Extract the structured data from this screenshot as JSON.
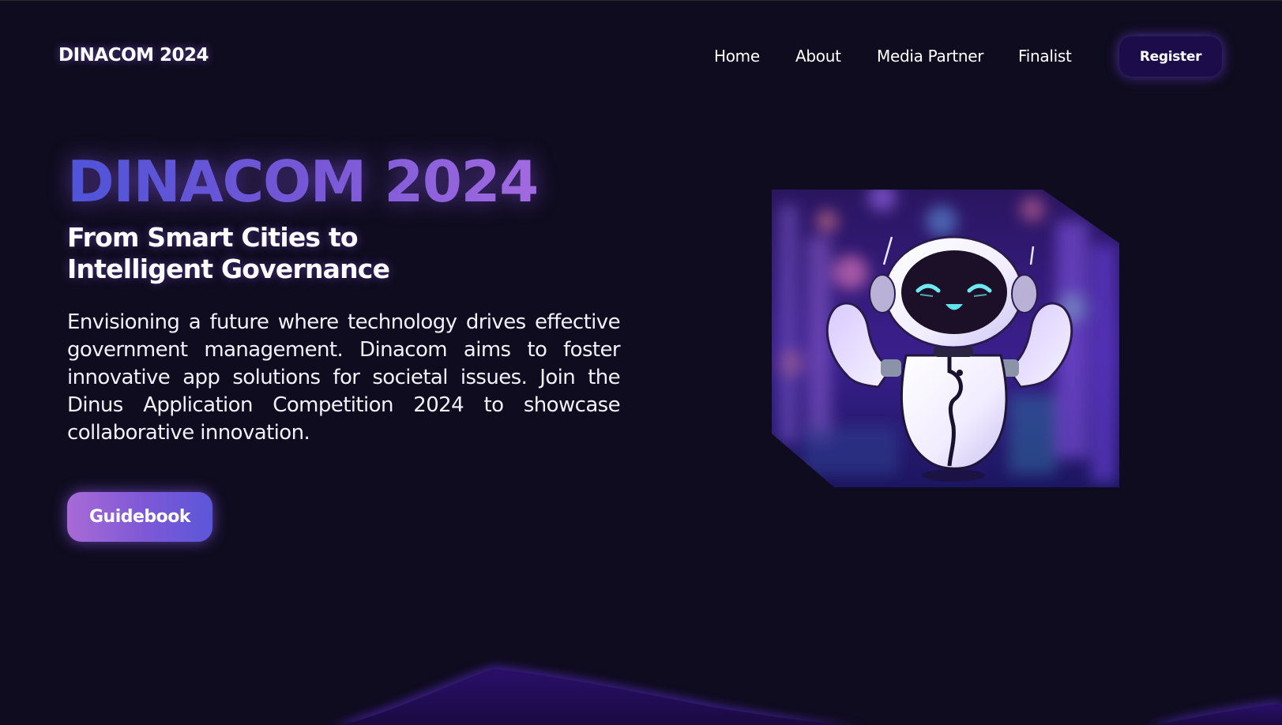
{
  "brand": {
    "name": "DINACOM 2024"
  },
  "nav": {
    "items": [
      {
        "label": "Home"
      },
      {
        "label": "About"
      },
      {
        "label": "Media Partner"
      },
      {
        "label": "Finalist"
      }
    ],
    "register_label": "Register"
  },
  "hero": {
    "title": "DINACOM 2024",
    "subtitle": "From Smart Cities to Intelligent Governance",
    "description": "Envisioning a future where technology drives effective government management. Dinacom aims to foster innovative app solutions for societal issues. Join the Dinus Application Competition 2024 to showcase collaborative innovation.",
    "cta_label": "Guidebook",
    "image_icon": "robot-mascot-icon"
  },
  "colors": {
    "background": "#0f0c1f",
    "accent_purple": "#7c58d6",
    "accent_blue": "#4e54d8",
    "register_bg": "#1d0c4a"
  }
}
